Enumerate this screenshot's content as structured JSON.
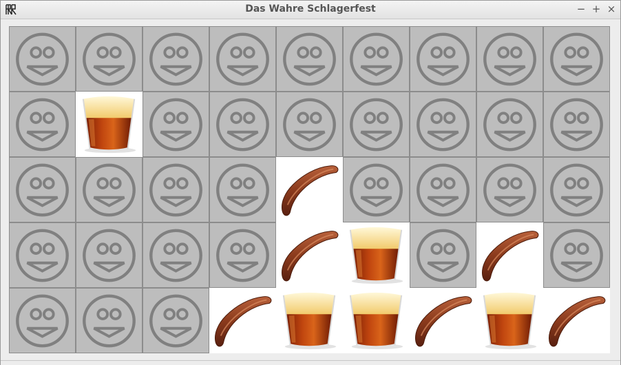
{
  "window": {
    "title": "Das Wahre Schlagerfest",
    "controls": {
      "minimize": "−",
      "maximize": "+",
      "close": "×"
    }
  },
  "board": {
    "rows": 5,
    "cols": 9,
    "tiles": [
      [
        "smiley",
        "smiley",
        "smiley",
        "smiley",
        "smiley",
        "smiley",
        "smiley",
        "smiley",
        "smiley"
      ],
      [
        "smiley",
        "beer",
        "smiley",
        "smiley",
        "smiley",
        "smiley",
        "smiley",
        "smiley",
        "smiley"
      ],
      [
        "smiley",
        "smiley",
        "smiley",
        "smiley",
        "sausage",
        "smiley",
        "smiley",
        "smiley",
        "smiley"
      ],
      [
        "smiley",
        "smiley",
        "smiley",
        "smiley",
        "sausage",
        "beer",
        "smiley",
        "sausage",
        "smiley"
      ],
      [
        "smiley",
        "smiley",
        "smiley",
        "sausage",
        "beer",
        "beer",
        "sausage",
        "beer",
        "sausage"
      ]
    ]
  },
  "icons": {
    "smiley": "smiley-icon",
    "beer": "beer-glass-icon",
    "sausage": "sausage-icon"
  },
  "colors": {
    "tile_hidden": "#bdbdbd",
    "smiley_stroke": "#808080",
    "tile_open": "#ffffff"
  }
}
